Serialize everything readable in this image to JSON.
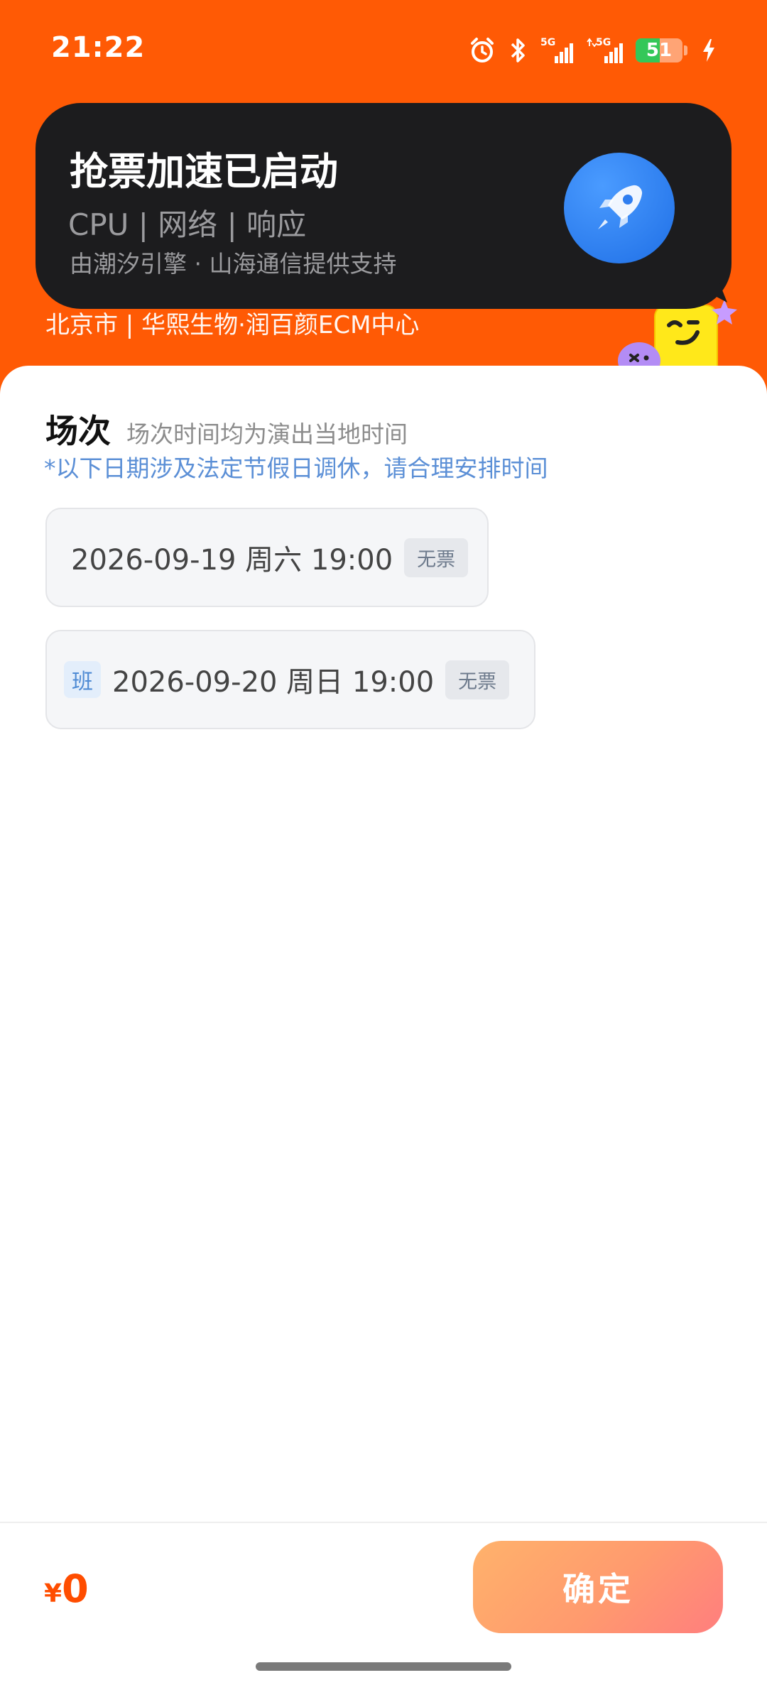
{
  "status_bar": {
    "time": "21:22",
    "signal_1_label": "5G",
    "signal_2_label": "5G",
    "battery_level": "51",
    "battery_fraction": 0.51
  },
  "boost_banner": {
    "title": "抢票加速已启动",
    "metrics": "CPU | 网络 | 响应",
    "credit": "由潮汐引擎 · 山海通信提供支持",
    "icon": "rocket-icon"
  },
  "venue": {
    "line": "北京市 | 华熙生物·润百颜ECM中心"
  },
  "sessions": {
    "title": "场次",
    "subtitle": "场次时间均为演出当地时间",
    "note": "*以下日期涉及法定节假日调休，请合理安排时间",
    "items": [
      {
        "badge": "",
        "date": "2026-09-19  周六 19:00",
        "tag": "无票"
      },
      {
        "badge": "班",
        "date": "2026-09-20 周日 19:00",
        "tag": "无票"
      }
    ]
  },
  "footer": {
    "currency": "¥",
    "price": "0",
    "confirm_label": "确定"
  },
  "colors": {
    "brand_orange": "#ff5a05",
    "price": "#ff4d00",
    "note_blue": "#5b8fd6",
    "rocket_blue": "#1f6fe6"
  }
}
